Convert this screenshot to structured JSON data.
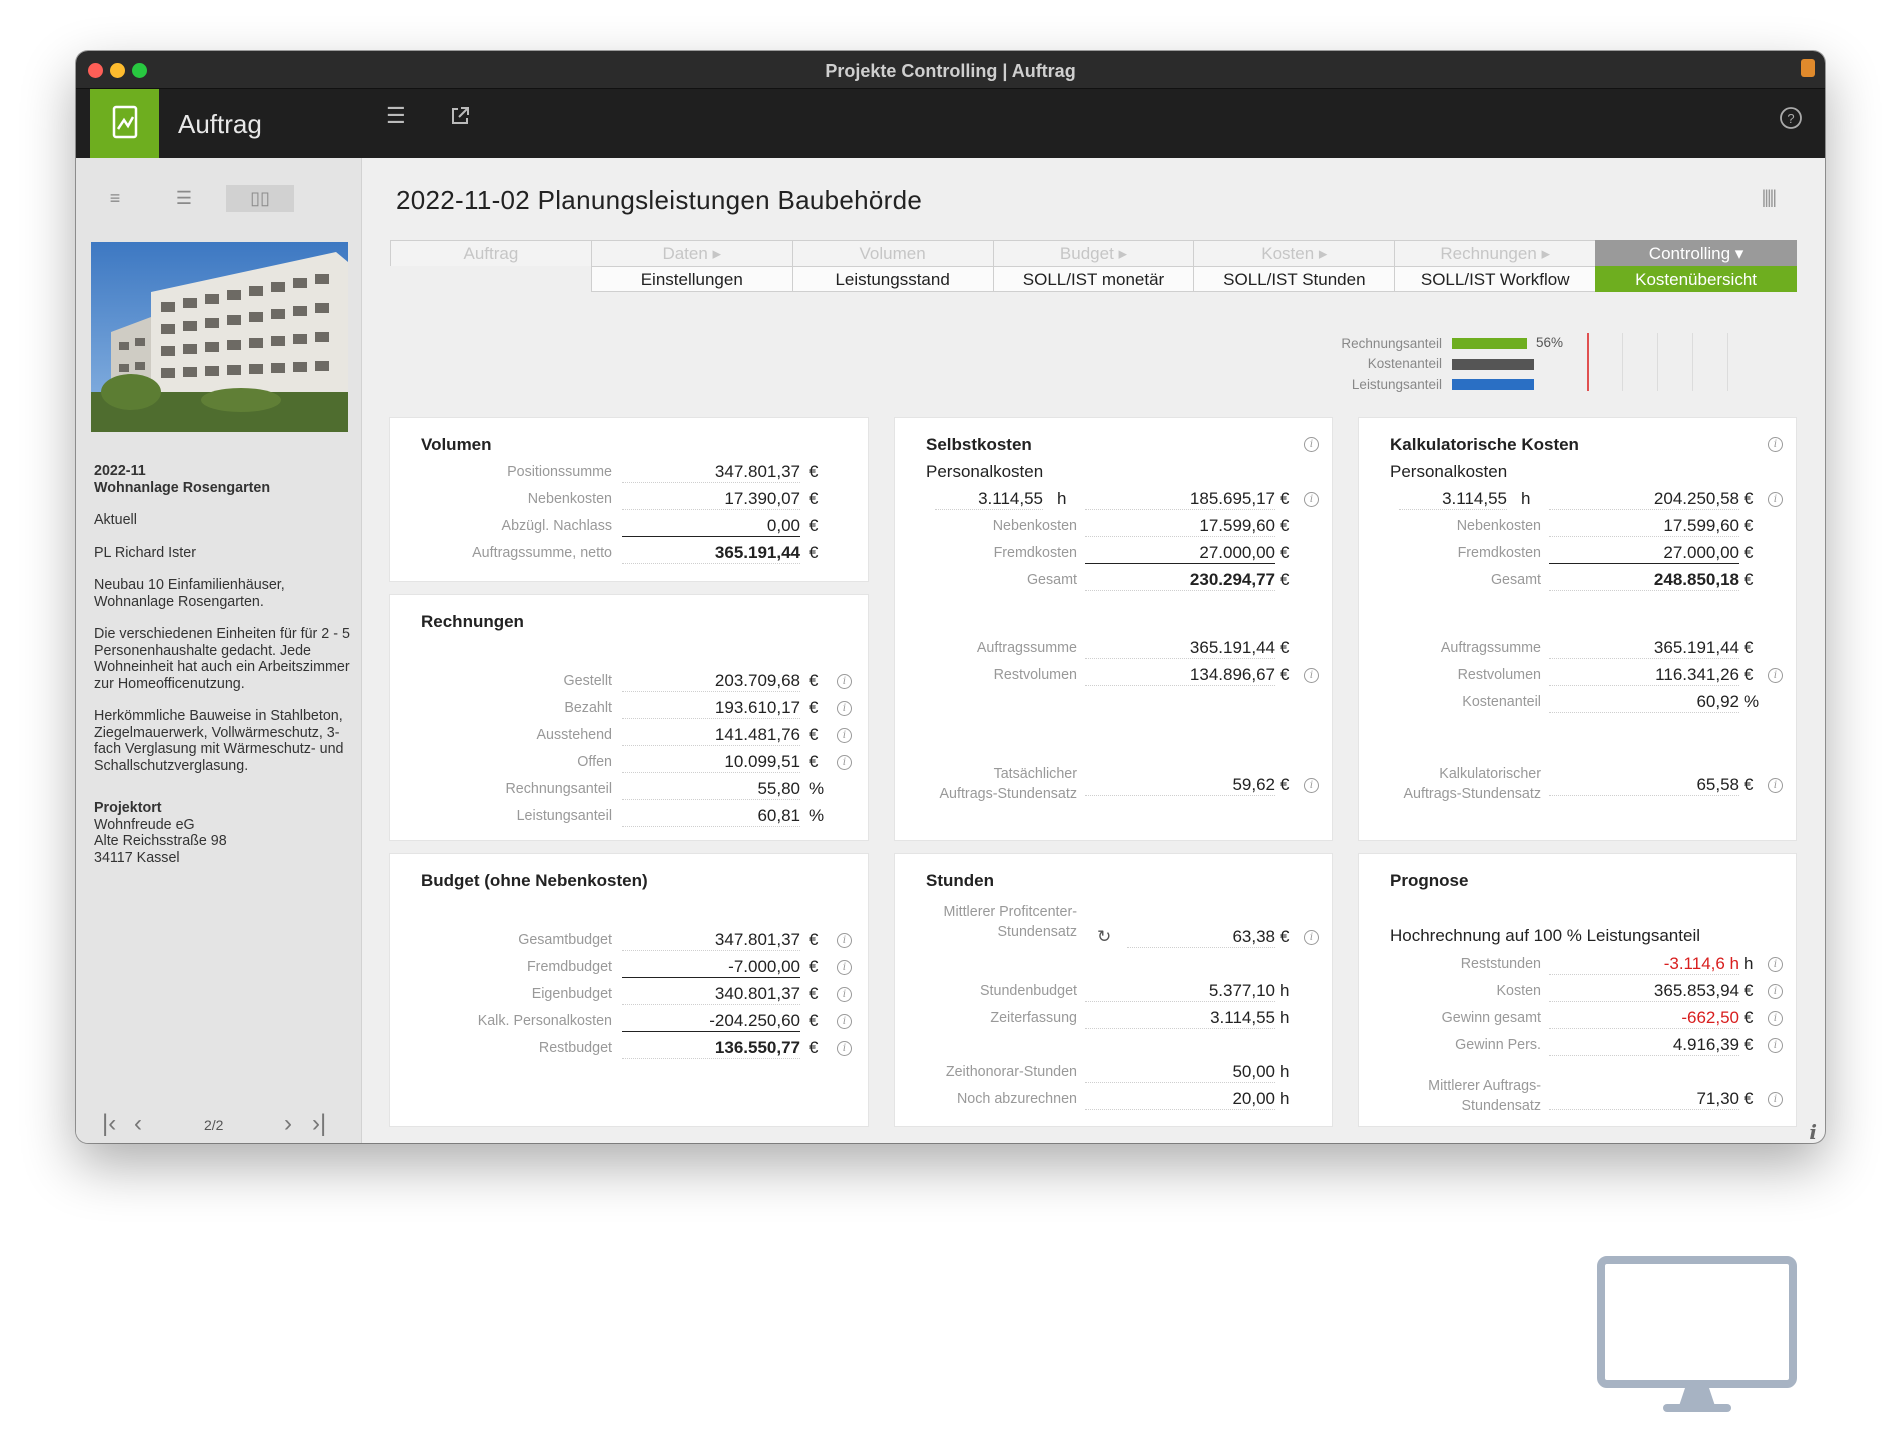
{
  "window": {
    "title": "Projekte Controlling | Auftrag",
    "app_title": "Auftrag",
    "accent_color": "#6eae1f"
  },
  "sidebar": {
    "view_buttons": [
      "list-view-icon",
      "detail-list-view-icon",
      "gallery-view-icon"
    ],
    "project_code": "2022-11",
    "project_name": "Wohnanlage Rosengarten",
    "status": "Aktuell",
    "manager": "PL Richard Ister",
    "description1": "Neubau 10 Einfamilienhäuser, Wohnanlage Rosengarten.",
    "description2": "Die verschiedenen Einheiten für für 2 - 5 Personenhaushalte gedacht. Jede Wohneinheit hat auch ein Arbeitszimmer zur Homeofficenutzung.",
    "description3": "Herkömmliche Bauweise in Stahlbeton, Ziegelmauerwerk, Vollwärmeschutz, 3-fach Verglasung mit Wärmeschutz- und Schallschutzverglasung.",
    "location_label": "Projektort",
    "location_line1": "Wohnfreude eG",
    "location_line2": "Alte Reichsstraße 98",
    "location_line3": "34117 Kassel",
    "pager": "2/2"
  },
  "main": {
    "page_title": "2022-11-02 Planungsleistungen Baubehörde",
    "tabs_top": [
      "Auftrag",
      "Daten ▸",
      "Volumen",
      "Budget ▸",
      "Kosten ▸",
      "Rechnungen ▸",
      "Controlling ▾"
    ],
    "tabs_bottom": [
      "",
      "Einstellungen",
      "Leistungsstand",
      "SOLL/IST monetär",
      "SOLL/IST Stunden",
      "SOLL/IST Workflow",
      "Kostenübersicht"
    ],
    "legend": {
      "rechnungsanteil_label": "Rechnungsanteil",
      "kostenanteil_label": "Kostenanteil",
      "leistungsanteil_label": "Leistungsanteil",
      "rechnungsanteil_pct_text": "56%",
      "rechnungsanteil_value": 0.558,
      "kostenanteil_value": 0.6092,
      "leistungsanteil_value": 0.6081,
      "colors": {
        "rechnung": "#6eae1f",
        "kosten": "#555555",
        "leistung": "#2a6fc4",
        "marker": "#e04040"
      }
    },
    "volumen": {
      "title": "Volumen",
      "rows": [
        {
          "label": "Positionssumme",
          "value": "347.801,37",
          "unit": "€"
        },
        {
          "label": "Nebenkosten",
          "value": "17.390,07",
          "unit": "€"
        },
        {
          "label": "Abzügl. Nachlass",
          "value": "0,00",
          "unit": "€"
        },
        {
          "label": "Auftragssumme, netto",
          "value": "365.191,44",
          "unit": "€"
        }
      ]
    },
    "rechnungen": {
      "title": "Rechnungen",
      "rows": [
        {
          "label": "Gestellt",
          "value": "203.709,68",
          "unit": "€"
        },
        {
          "label": "Bezahlt",
          "value": "193.610,17",
          "unit": "€"
        },
        {
          "label": "Ausstehend",
          "value": "141.481,76",
          "unit": "€"
        },
        {
          "label": "Offen",
          "value": "10.099,51",
          "unit": "€"
        },
        {
          "label": "Rechnungsanteil",
          "value": "55,80",
          "unit": "%"
        },
        {
          "label": "Leistungsanteil",
          "value": "60,81",
          "unit": "%"
        }
      ]
    },
    "budget": {
      "title": "Budget (ohne Nebenkosten)",
      "rows": [
        {
          "label": "Gesamtbudget",
          "value": "347.801,37",
          "unit": "€"
        },
        {
          "label": "Fremdbudget",
          "value": "-7.000,00",
          "unit": "€"
        },
        {
          "label": "Eigenbudget",
          "value": "340.801,37",
          "unit": "€"
        },
        {
          "label": "Kalk. Personalkosten",
          "value": "-204.250,60",
          "unit": "€"
        },
        {
          "label": "Restbudget",
          "value": "136.550,77",
          "unit": "€"
        }
      ]
    },
    "selbstkosten": {
      "title": "Selbstkosten",
      "subtitle": "Personalkosten",
      "hours": "3.114,55",
      "hours_unit": "h",
      "personal_value": "185.695,17",
      "rows": [
        {
          "label": "Nebenkosten",
          "value": "17.599,60",
          "unit": "€"
        },
        {
          "label": "Fremdkosten",
          "value": "27.000,00",
          "unit": "€"
        },
        {
          "label": "Gesamt",
          "value": "230.294,77",
          "unit": "€"
        },
        {
          "label": "Auftragssumme",
          "value": "365.191,44",
          "unit": "€"
        },
        {
          "label": "Restvolumen",
          "value": "134.896,67",
          "unit": "€"
        }
      ],
      "rate_label1": "Tatsächlicher",
      "rate_label2": "Auftrags-Stundensatz",
      "rate_value": "59,62",
      "unit_eur": "€"
    },
    "kalkulatorisch": {
      "title": "Kalkulatorische Kosten",
      "subtitle": "Personalkosten",
      "hours": "3.114,55",
      "hours_unit": "h",
      "personal_value": "204.250,58",
      "rows": [
        {
          "label": "Nebenkosten",
          "value": "17.599,60",
          "unit": "€"
        },
        {
          "label": "Fremdkosten",
          "value": "27.000,00",
          "unit": "€"
        },
        {
          "label": "Gesamt",
          "value": "248.850,18",
          "unit": "€"
        },
        {
          "label": "Auftragssumme",
          "value": "365.191,44",
          "unit": "€"
        },
        {
          "label": "Restvolumen",
          "value": "116.341,26",
          "unit": "€"
        },
        {
          "label": "Kostenanteil",
          "value": "60,92",
          "unit": "%"
        }
      ],
      "rate_label1": "Kalkulatorischer",
      "rate_label2": "Auftrags-Stundensatz",
      "rate_value": "65,58",
      "unit_eur": "€"
    },
    "stunden": {
      "title": "Stunden",
      "profit_label1": "Mittlerer Profitcenter-",
      "profit_label2": "Stundensatz",
      "profit_value": "63,38",
      "profit_unit": "€",
      "rows": [
        {
          "label": "Stundenbudget",
          "value": "5.377,10",
          "unit": "h"
        },
        {
          "label": "Zeiterfassung",
          "value": "3.114,55",
          "unit": "h"
        },
        {
          "label": "Zeithonorar-Stunden",
          "value": "50,00",
          "unit": "h"
        },
        {
          "label": "Noch abzurechnen",
          "value": "20,00",
          "unit": "h"
        }
      ]
    },
    "prognose": {
      "title": "Prognose",
      "subtitle": "Hochrechnung auf 100 % Leistungsanteil",
      "rows": [
        {
          "label": "Reststunden",
          "value": "-3.114,6 h",
          "unit": "h"
        },
        {
          "label": "Kosten",
          "value": "365.853,94",
          "unit": "€"
        },
        {
          "label": "Gewinn gesamt",
          "value": "-662,50",
          "unit": "€"
        },
        {
          "label": "Gewinn Pers.",
          "value": "4.916,39",
          "unit": "€"
        }
      ],
      "rate_label1": "Mittlerer Auftrags-",
      "rate_label2": "Stundensatz",
      "rate_value": "71,30",
      "unit_eur": "€",
      "negative_color": "#d81e1e"
    }
  }
}
